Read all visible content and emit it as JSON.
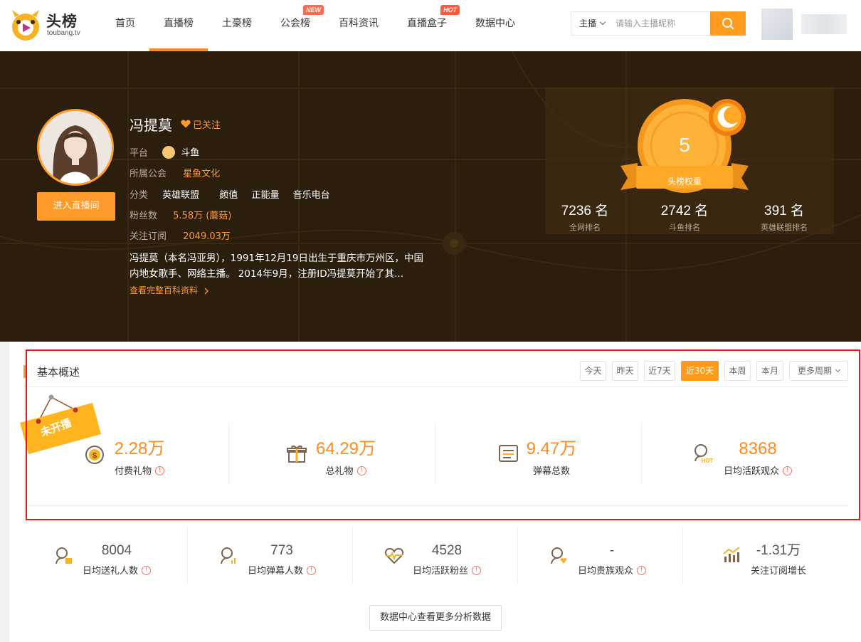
{
  "brand": {
    "name": "头榜",
    "domain": "toubang.tv"
  },
  "nav": {
    "items": [
      {
        "label": "首页"
      },
      {
        "label": "直播榜",
        "active": true
      },
      {
        "label": "土豪榜"
      },
      {
        "label": "公会榜",
        "badge": "NEW"
      },
      {
        "label": "百科资讯"
      },
      {
        "label": "直播盒子",
        "badge": "HOT"
      },
      {
        "label": "数据中心"
      }
    ]
  },
  "search": {
    "type": "主播",
    "placeholder": "请输入主播昵称",
    "icon": "search-icon"
  },
  "streamer": {
    "name": "冯提莫",
    "follow_label": "已关注",
    "enter_label": "进入直播间",
    "platform_label": "平台",
    "platform": "斗鱼",
    "guild_label": "所属公会",
    "guild": "星鱼文化",
    "category_label": "分类",
    "categories": [
      "英雄联盟",
      "颜值",
      "正能量",
      "音乐电台"
    ],
    "fans_label": "粉丝数",
    "fans": "5.58万 (蘑菇)",
    "subs_label": "关注订阅",
    "subs": "2049.03万",
    "description": "冯提莫（本名冯亚男），1991年12月19日出生于重庆市万州区，中国内地女歌手、网络主播。 2014年9月，注册ID冯提莫开始了其...",
    "more_link": "查看完整百科资料"
  },
  "ranking": {
    "weight_value": "5",
    "weight_label": "头榜权重",
    "ranks": [
      {
        "value": "7236 名",
        "label": "全网排名"
      },
      {
        "value": "2742 名",
        "label": "斗鱼排名"
      },
      {
        "value": "391 名",
        "label": "英雄联盟排名"
      }
    ]
  },
  "overview": {
    "title": "基本概述",
    "status_tag": "未开播",
    "periods": [
      {
        "label": "今天"
      },
      {
        "label": "昨天"
      },
      {
        "label": "近7天"
      },
      {
        "label": "近30天",
        "active": true
      },
      {
        "label": "本周"
      },
      {
        "label": "本月"
      },
      {
        "label": "更多周期"
      }
    ],
    "primary_stats": [
      {
        "value": "2.28万",
        "label": "付费礼物",
        "icon": "coin-icon",
        "info": true
      },
      {
        "value": "64.29万",
        "label": "总礼物",
        "icon": "gift-icon",
        "info": true
      },
      {
        "value": "9.47万",
        "label": "弹幕总数",
        "icon": "barrage-icon",
        "info": false
      },
      {
        "value": "8368",
        "label": "日均活跃观众",
        "icon": "hot-viewer-icon",
        "info": true
      }
    ],
    "secondary_stats": [
      {
        "value": "8004",
        "label": "日均送礼人数",
        "icon": "gift-user-icon",
        "info": true
      },
      {
        "value": "773",
        "label": "日均弹幕人数",
        "icon": "barrage-user-icon",
        "info": true
      },
      {
        "value": "4528",
        "label": "日均活跃粉丝",
        "icon": "heart-pulse-icon",
        "info": true
      },
      {
        "value": "-",
        "label": "日均贵族观众",
        "icon": "noble-user-icon",
        "info": true
      },
      {
        "value": "-1.31万",
        "label": "关注订阅增长",
        "icon": "growth-chart-icon",
        "info": false
      }
    ],
    "more_button": "数据中心查看更多分析数据"
  },
  "colors": {
    "accent": "#ff9a2a",
    "hero_bg": "#2b1e0d",
    "info": "#ff6b5a",
    "highlight_box": "#e81818"
  }
}
